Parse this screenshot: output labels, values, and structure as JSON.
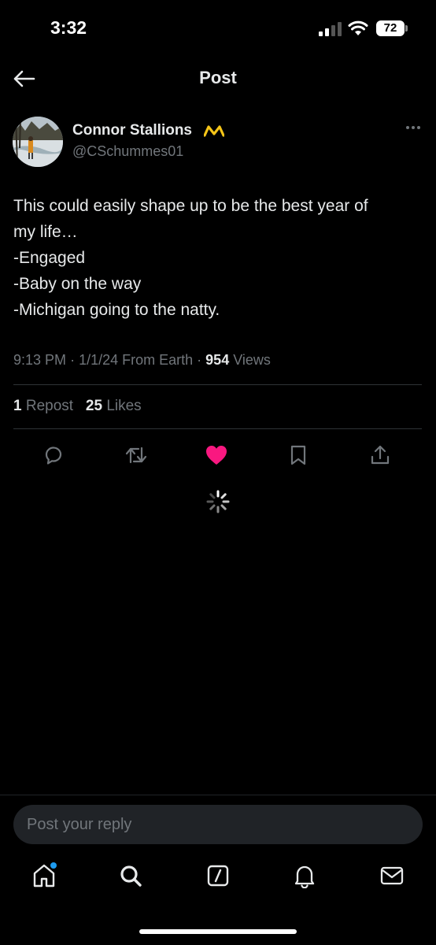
{
  "status_bar": {
    "time": "3:32",
    "battery": "72"
  },
  "header": {
    "title": "Post"
  },
  "post": {
    "author_name": "Connor Stallions",
    "author_handle": "@CSchummes01",
    "text_lines": [
      "This could easily shape up to be the best year of",
      "my life…",
      "-Engaged",
      "-Baby on the way",
      "-Michigan going to the natty."
    ],
    "time": "9:13 PM",
    "date": "1/1/24",
    "source": "From Earth",
    "views_count": "954",
    "views_label": "Views",
    "reposts_count": "1",
    "reposts_label": "Repost",
    "likes_count": "25",
    "likes_label": "Likes"
  },
  "actions": {
    "reply_icon": "reply-icon",
    "repost_icon": "repost-icon",
    "like_icon": "heart-icon",
    "like_color": "#f91880",
    "bookmark_icon": "bookmark-icon",
    "share_icon": "share-icon"
  },
  "reply": {
    "placeholder": "Post your reply"
  },
  "tabs": [
    "home-icon",
    "search-icon",
    "grok-icon",
    "notifications-icon",
    "messages-icon"
  ],
  "colors": {
    "background": "#000000",
    "text": "#e7e9ea",
    "secondary": "#71767b",
    "accent": "#1d9bf0",
    "crown": "#f5c518"
  }
}
